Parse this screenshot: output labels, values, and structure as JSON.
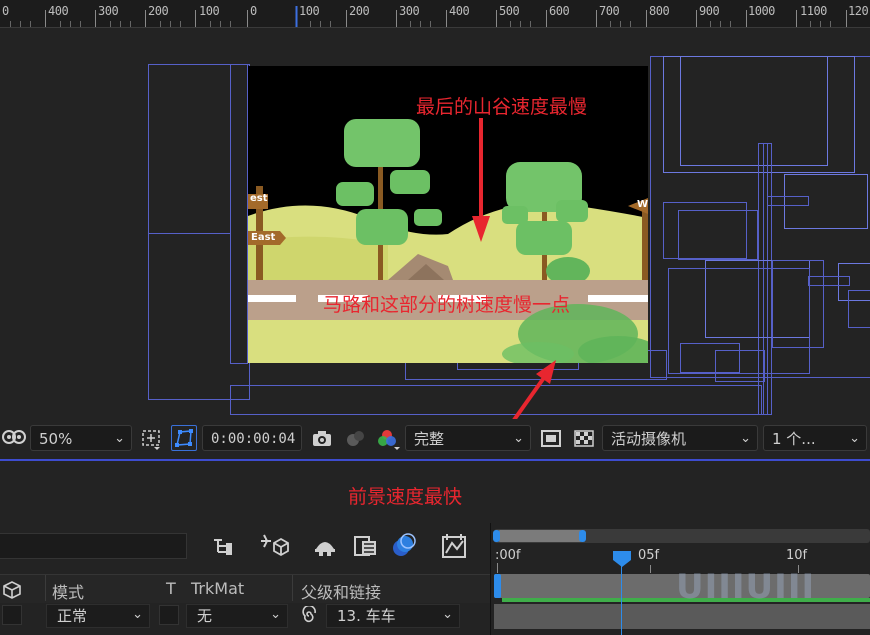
{
  "ruler": {
    "labels": [
      "0",
      "400",
      "300",
      "200",
      "100",
      "0",
      "100",
      "200",
      "300",
      "400",
      "500",
      "600",
      "700",
      "800",
      "900",
      "1000",
      "1100",
      "120"
    ]
  },
  "canvas": {
    "sign_left_top": "est",
    "sign_left_bottom": "East",
    "sign_right": "W"
  },
  "annotations": {
    "valley": "最后的山谷速度最慢",
    "road": "马路和这部分的树速度慢一点",
    "foreground": "前景速度最快"
  },
  "toolbar": {
    "zoom": "50%",
    "timecode": "0:00:00:04",
    "resolution": "完整",
    "camera": "活动摄像机",
    "views": "1 个..."
  },
  "timeline": {
    "ticks": [
      ":00f",
      "05f",
      "10f"
    ],
    "columns": {
      "mode": "模式",
      "t": "T",
      "trkmat": "TrkMat",
      "parent": "父级和链接"
    },
    "row": {
      "mode": "正常",
      "trkmat": "无",
      "parent": "13. 车车"
    }
  },
  "watermark": "UIIIUIII",
  "colors": {
    "accent_blue": "#2d8ceb",
    "annotation_red": "#e8262f",
    "wire_blue": "#5660c8"
  }
}
